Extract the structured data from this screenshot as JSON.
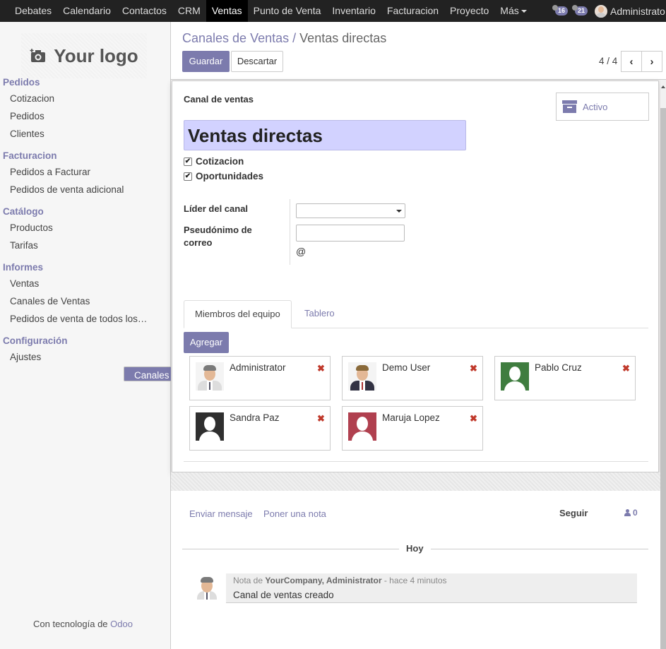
{
  "topbar": {
    "menu": [
      "Debates",
      "Calendario",
      "Contactos",
      "CRM",
      "Ventas",
      "Punto de Venta",
      "Inventario",
      "Facturacion",
      "Proyecto"
    ],
    "more_label": "Más",
    "active_index": 4,
    "badge_messages": "16",
    "badge_chat": "21",
    "user_name": "Administrato"
  },
  "sidebar": {
    "logo_text": "Your logo",
    "sections": [
      {
        "title": "Pedidos",
        "items": [
          "Cotizacion",
          "Pedidos",
          "Clientes"
        ]
      },
      {
        "title": "Facturacion",
        "items": [
          "Pedidos a Facturar",
          "Pedidos de venta adicional"
        ]
      },
      {
        "title": "Catálogo",
        "items": [
          "Productos",
          "Tarifas"
        ]
      },
      {
        "title": "Informes",
        "items": [
          "Ventas",
          "Canales de Ventas",
          "Pedidos de venta de todos los…"
        ]
      },
      {
        "title": "Configuración",
        "items": [
          "Ajustes",
          "Canales de Ventas"
        ]
      }
    ],
    "powered_prefix": "Con tecnología de ",
    "powered_brand": "Odoo"
  },
  "control": {
    "breadcrumb_parent": "Canales de Ventas",
    "breadcrumb_sep": "/",
    "breadcrumb_current": "Ventas directas",
    "save_label": "Guardar",
    "discard_label": "Descartar",
    "pager": "4 / 4"
  },
  "form": {
    "section_label": "Canal de ventas",
    "active_button": "Activo",
    "name": "Ventas directas",
    "checkbox_quotation": "Cotizacion",
    "checkbox_opportunities": "Oportunidades",
    "leader_label": "Líder del canal",
    "alias_label_1": "Pseudónimo de",
    "alias_label_2": "correo",
    "alias_at": "@",
    "tab_members": "Miembros del equipo",
    "tab_dashboard": "Tablero",
    "add_button": "Agregar",
    "members": [
      "Administrator",
      "Demo User",
      "Pablo Cruz",
      "Sandra Paz",
      "Maruja Lopez"
    ],
    "remove_icon": "✖"
  },
  "chatter": {
    "send_message": "Enviar mensaje",
    "log_note": "Poner una nota",
    "follow": "Seguir",
    "followers_count": "0",
    "day_label": "Hoy",
    "msg_prefix": "Nota de ",
    "msg_author": "YourCompany, Administrator",
    "msg_time": " - hace 4 minutos",
    "msg_body": "Canal de ventas creado"
  }
}
